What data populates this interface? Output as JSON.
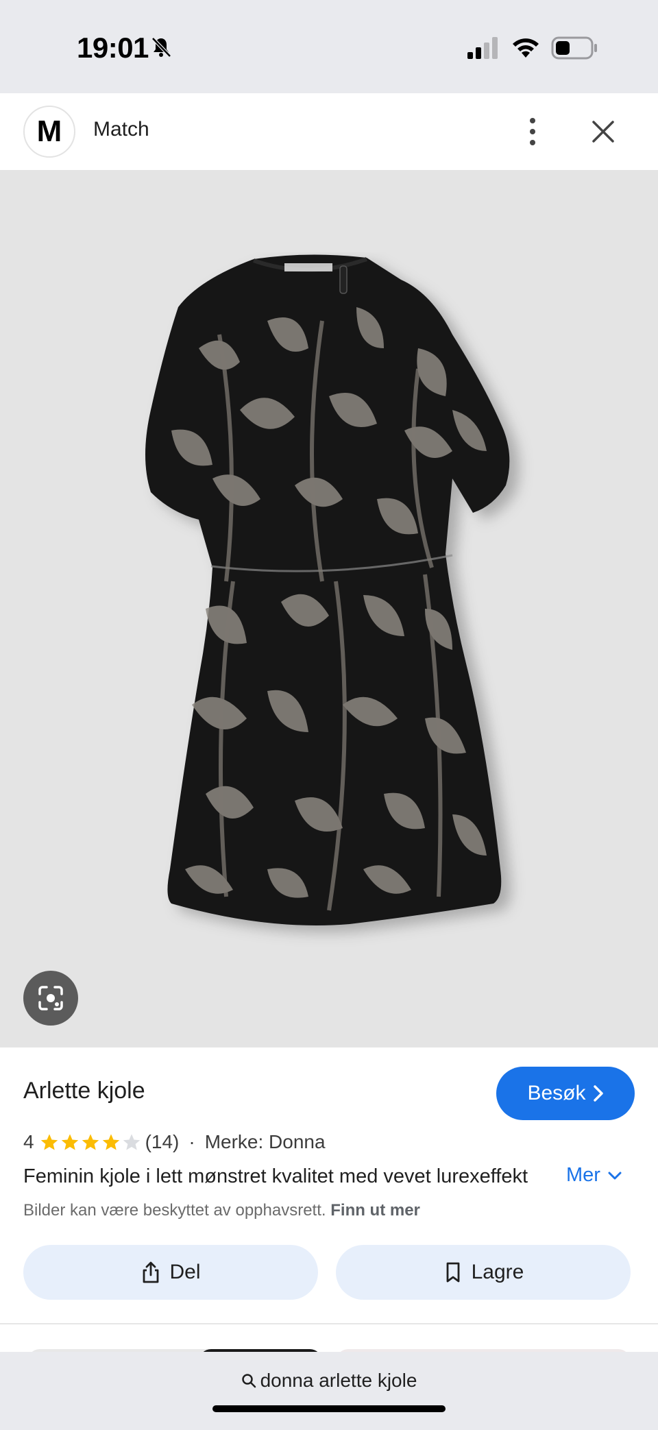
{
  "status_bar": {
    "time": "19:01"
  },
  "header": {
    "logo_letter": "M",
    "site_name": "Match"
  },
  "product": {
    "title": "Arlette kjole",
    "visit_label": "Besøk",
    "rating_value": "4",
    "rating_stars": 4,
    "review_count": "(14)",
    "separator": "·",
    "brand": "Merke: Donna",
    "description": "Feminin kjole i lett mønstret kvalitet med vevet lurexeffekt",
    "more_label": "Mer",
    "copyright_text": "Bilder kan være beskyttet av opphavsrett.",
    "copyright_link": "Finn ut mer"
  },
  "actions": {
    "share_label": "Del",
    "save_label": "Lagre"
  },
  "bottom_bar": {
    "search_query": "donna arlette kjole"
  },
  "colors": {
    "accent": "#1a73e8",
    "star": "#fbbc04",
    "chip_bg": "#e7effb"
  },
  "icons": [
    "bell-slash-icon",
    "signal-icon",
    "wifi-icon",
    "battery-icon",
    "more-vertical-icon",
    "close-icon",
    "lens-icon",
    "chevron-right-icon",
    "star-icon",
    "chevron-down-icon",
    "share-icon",
    "bookmark-icon",
    "search-icon"
  ]
}
